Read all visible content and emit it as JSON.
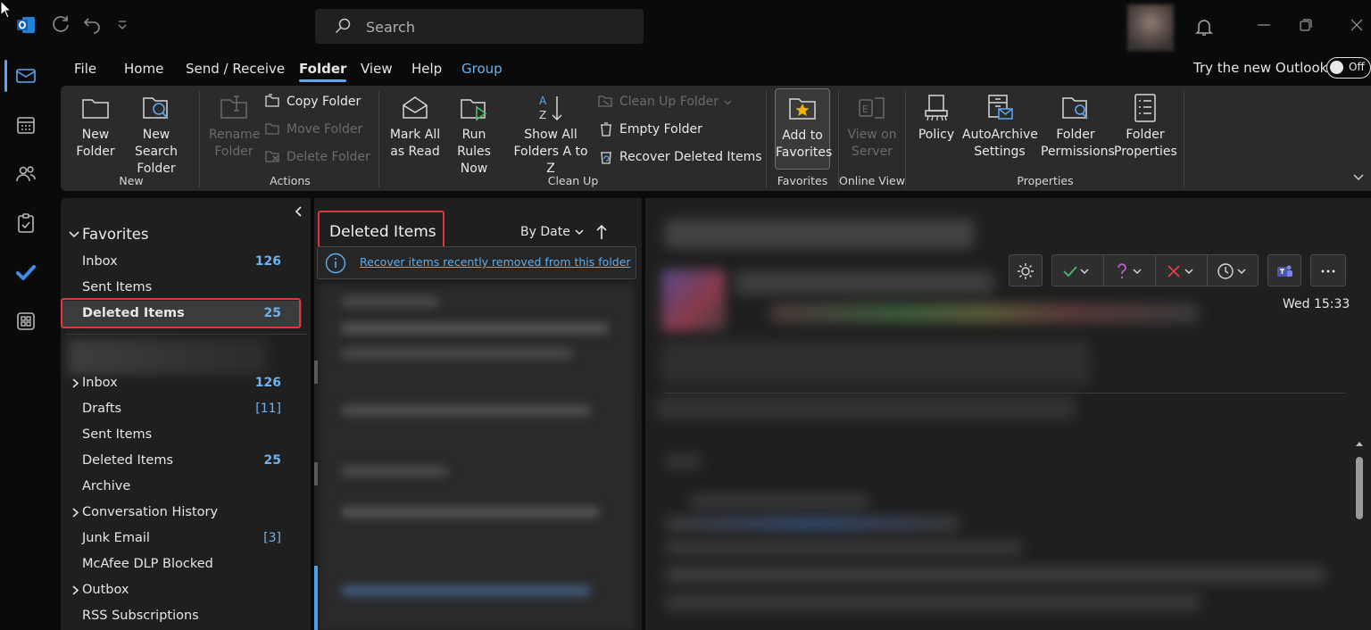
{
  "titlebar": {
    "search_placeholder": "Search"
  },
  "menu": {
    "tabs": [
      {
        "label": "File"
      },
      {
        "label": "Home"
      },
      {
        "label": "Send / Receive"
      },
      {
        "label": "Folder"
      },
      {
        "label": "View"
      },
      {
        "label": "Help"
      },
      {
        "label": "Group"
      }
    ],
    "active_tab": "Folder",
    "try_new_outlook": "Try the new Outlook",
    "toggle_state": "Off"
  },
  "ribbon": {
    "new_folder": "New Folder",
    "new_search_folder": "New Search Folder",
    "rename_folder": "Rename Folder",
    "copy_folder": "Copy Folder",
    "move_folder": "Move Folder",
    "delete_folder": "Delete Folder",
    "mark_all_as_read": "Mark All as Read",
    "run_rules_now": "Run Rules Now",
    "show_all_folders_a_to_z": "Show All Folders A to Z",
    "clean_up_folder": "Clean Up Folder",
    "empty_folder": "Empty Folder",
    "recover_deleted_items": "Recover Deleted Items",
    "add_to_favorites": "Add to Favorites",
    "view_on_server": "View on Server",
    "policy": "Policy",
    "autoarchive_settings": "AutoArchive Settings",
    "folder_permissions": "Folder Permissions",
    "folder_properties": "Folder Properties",
    "groups": {
      "new": "New",
      "actions": "Actions",
      "clean_up": "Clean Up",
      "favorites": "Favorites",
      "online_view": "Online View",
      "properties": "Properties"
    }
  },
  "folder_pane": {
    "favorites_header": "Favorites",
    "favorites": [
      {
        "name": "Inbox",
        "count": "126"
      },
      {
        "name": "Sent Items",
        "count": ""
      },
      {
        "name": "Deleted Items",
        "count": "25"
      }
    ],
    "folders": [
      {
        "name": "Inbox",
        "count": "126"
      },
      {
        "name": "Drafts",
        "count": "[11]"
      },
      {
        "name": "Sent Items",
        "count": ""
      },
      {
        "name": "Deleted Items",
        "count": "25"
      },
      {
        "name": "Archive",
        "count": ""
      },
      {
        "name": "Conversation History",
        "count": ""
      },
      {
        "name": "Junk Email",
        "count": "[3]"
      },
      {
        "name": "McAfee DLP Blocked",
        "count": ""
      },
      {
        "name": "Outbox",
        "count": ""
      },
      {
        "name": "RSS Subscriptions",
        "count": ""
      }
    ]
  },
  "message_list": {
    "title": "Deleted Items",
    "sort_label": "By Date",
    "recover_link": "Recover items recently removed from this folder"
  },
  "reading_pane": {
    "received_time": "Wed 15:33"
  },
  "colors": {
    "accent": "#5ea7ee",
    "highlight_red": "#e0353b",
    "count_blue": "#6bb2f0"
  },
  "icons": [
    "outlook-logo-icon",
    "refresh-icon",
    "undo-icon",
    "customize-icon",
    "search-icon",
    "bell-icon",
    "minimize-icon",
    "restore-icon",
    "close-icon",
    "mail-icon",
    "calendar-icon",
    "people-icon",
    "tasks-icon",
    "todo-icon",
    "apps-icon"
  ]
}
